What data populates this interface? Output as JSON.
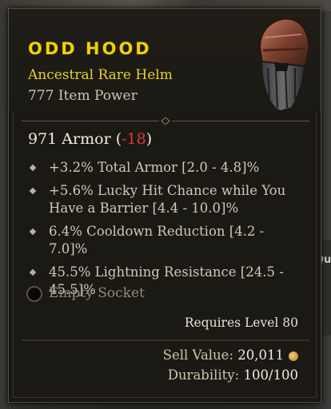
{
  "item": {
    "name": "ODD HOOD",
    "type_line": "Ancestral Rare Helm",
    "item_power": "777 Item Power",
    "armor_value": "971 Armor",
    "armor_open": "(",
    "armor_delta": "-18",
    "armor_close": ")",
    "affixes": [
      "+3.2% Total Armor [2.0 - 4.8]%",
      "+5.6% Lucky Hit Chance while You Have a Barrier [4.4 - 10.0]%",
      "6.4% Cooldown Reduction [4.2 - 7.0]%",
      "45.5% Lightning Resistance [24.5 - 45.5]%"
    ],
    "socket_label": "Empty Socket",
    "requirement": "Requires Level 80",
    "sell_label": "Sell Value:",
    "sell_value": "20,011",
    "durability_label": "Durability:",
    "durability_value": "100/100"
  },
  "background": {
    "side_tab_label": "Qu"
  },
  "colors": {
    "title": "#f2d200",
    "type_line": "#e9d02a",
    "negative": "#e4353a"
  },
  "icons": {
    "helm": "helm-icon",
    "gold": "gold-coin-icon",
    "socket": "socket-icon",
    "bullet": "diamond-bullet-icon"
  }
}
